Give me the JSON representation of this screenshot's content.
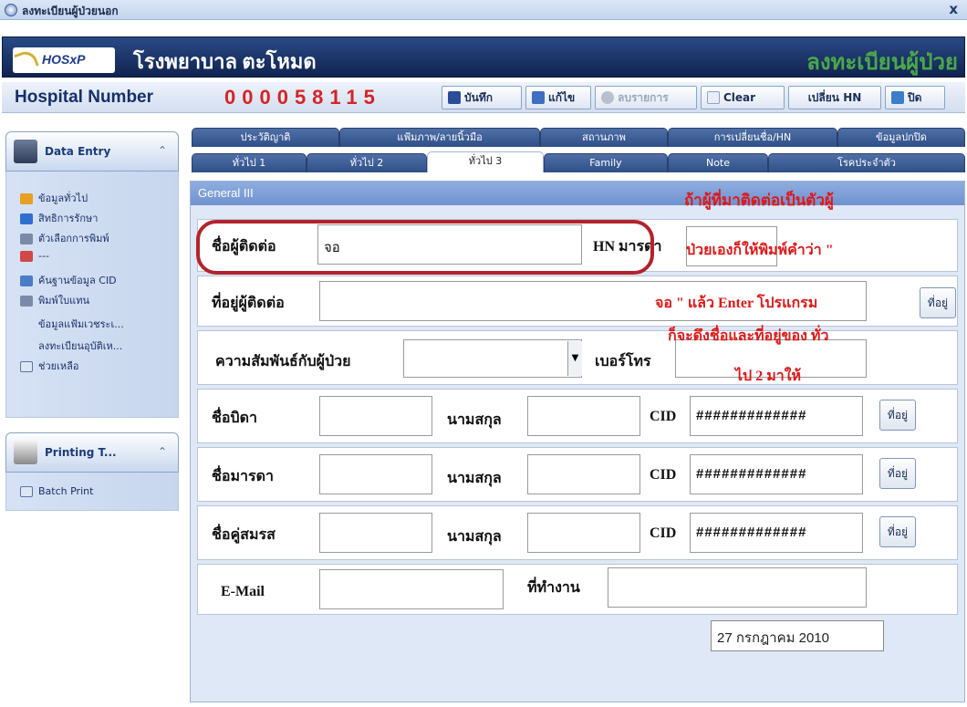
{
  "window": {
    "title": "ลงทะเบียนผู้ป่วยนอก"
  },
  "banner": {
    "logo_text": "HOSxP",
    "hospital_name": "โรงพยาบาล ตะโหมด",
    "form_title": "ลงทะเบียนผู้ป่วย"
  },
  "toolbar": {
    "hn_label": "Hospital Number",
    "hn_value": "000058115",
    "buttons": [
      {
        "label": "บันทึก",
        "icon": "save-icon",
        "enabled": true
      },
      {
        "label": "แก้ไข",
        "icon": "edit-icon",
        "enabled": true
      },
      {
        "label": "ลบรายการ",
        "icon": "delete-icon",
        "enabled": false
      },
      {
        "label": "Clear",
        "icon": "clear-icon",
        "enabled": true
      },
      {
        "label": "เปลี่ยน HN",
        "icon": "",
        "enabled": true
      },
      {
        "label": "ปิด",
        "icon": "exit-icon",
        "enabled": true
      }
    ]
  },
  "sidebar": {
    "groups": [
      {
        "title": "Data Entry",
        "items": [
          {
            "label": "ข้อมูลทั่วไป",
            "icon": "info-icon"
          },
          {
            "label": "สิทธิการรักษา",
            "icon": "rights-icon"
          },
          {
            "label": "ตัวเลือกการพิมพ์",
            "icon": "print-options-icon"
          },
          {
            "label": "---",
            "icon": "users-icon"
          },
          {
            "label": "ค้นฐานข้อมูล CID",
            "icon": "search-db-icon"
          },
          {
            "label": "พิมพ์ใบแทน",
            "icon": "print-icon"
          },
          {
            "label": "ข้อมูลแฟ้มเวชระเ...",
            "icon": ""
          },
          {
            "label": "ลงทะเบียนอุบัติเห...",
            "icon": ""
          },
          {
            "label": "ช่วยเหลือ",
            "icon": "help-icon"
          }
        ]
      },
      {
        "title": "Printing T...",
        "items": [
          {
            "label": "Batch Print",
            "icon": "batch-print-icon"
          }
        ]
      }
    ]
  },
  "tabs": {
    "row1": [
      "ประวัติญาติ",
      "แฟ้มภาพ/ลายนิ้วมือ",
      "สถานภาพ",
      "การเปลี่ยนชื่อ/HN",
      "ข้อมูลปกปิด"
    ],
    "row2": [
      "ทั่วไป 1",
      "ทั่วไป 2",
      "ทั่วไป 3",
      "Family",
      "Note",
      "โรคประจำตัว"
    ],
    "active": "ทั่วไป 3"
  },
  "panel": {
    "header": "General III",
    "contact_name_label": "ชื่อผู้ติดต่อ",
    "contact_name_value": "จอ",
    "hn_mother_label": "HN มารดา",
    "contact_address_label": "ที่อยู่ผู้ติดต่อ",
    "address_button": "ที่อยู่",
    "relation_label": "ความสัมพันธ์กับผู้ป่วย",
    "phone_label": "เบอร์โทร",
    "father_label": "ชื่อบิดา",
    "mother_label": "ชื่อมารดา",
    "spouse_label": "ชื่อคู่สมรส",
    "surname_label": "นามสกุล",
    "cid_label": "CID",
    "cid_value": "#############",
    "email_label": "E-Mail",
    "workplace_label": "ที่ทำงาน",
    "date": "27 กรกฎาคม 2010"
  },
  "annotation": {
    "lines": [
      "ถ้าผู้ที่มาติดต่อเป็นตัวผู้",
      "ป่วยเองก็ให้พิมพ์คำว่า \"",
      "จอ \" แล้ว Enter โปรแกรม",
      "ก็จะดึงชื่อและที่อยู่ของ ทั่ว",
      "ไป 2 มาให้"
    ]
  },
  "colors": {
    "hn_value": "#d42424",
    "form_title": "#4aa84a",
    "annotation": "#e01818",
    "highlight": "#b3232c"
  }
}
